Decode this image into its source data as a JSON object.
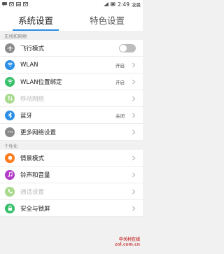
{
  "status_bar": {
    "time": "2:49",
    "carrier": "凌晨"
  },
  "tabs": [
    {
      "label": "系统设置",
      "active": true
    },
    {
      "label": "特色设置",
      "active": false
    }
  ],
  "sections": {
    "network": "无线和网络",
    "personal": "个性化"
  },
  "rows": {
    "airplane": {
      "label": "飞行模式",
      "icon": "airplane-icon",
      "color": "#8a8a8a",
      "toggle_on": false
    },
    "wlan": {
      "label": "WLAN",
      "status": "开启",
      "icon": "wifi-icon",
      "color": "#2b8ee6"
    },
    "wlan_bind": {
      "label": "WLAN位置绑定",
      "status": "开启",
      "icon": "wifi-location-icon",
      "color": "#36c06a"
    },
    "mobile": {
      "label": "移动网络",
      "icon": "mobile-data-icon",
      "color": "#a8d98c",
      "disabled": true
    },
    "bluetooth": {
      "label": "蓝牙",
      "status": "关闭",
      "icon": "bluetooth-icon",
      "color": "#2b8ee6"
    },
    "more_network": {
      "label": "更多网络设置",
      "icon": "more-icon",
      "color": "#8a8a8a"
    },
    "scenes": {
      "label": "情景模式",
      "icon": "bell-icon",
      "color": "#ff7a1a"
    },
    "sound": {
      "label": "铃声和音量",
      "icon": "music-note-icon",
      "color": "#b33cc9"
    },
    "call": {
      "label": "通话设置",
      "icon": "phone-icon",
      "color": "#a8d98c",
      "disabled": true
    },
    "security": {
      "label": "安全与锁屏",
      "icon": "lock-icon",
      "color": "#36c06a"
    }
  },
  "watermark": {
    "line1": "中关村在线",
    "line2": "zol.com.cn"
  }
}
